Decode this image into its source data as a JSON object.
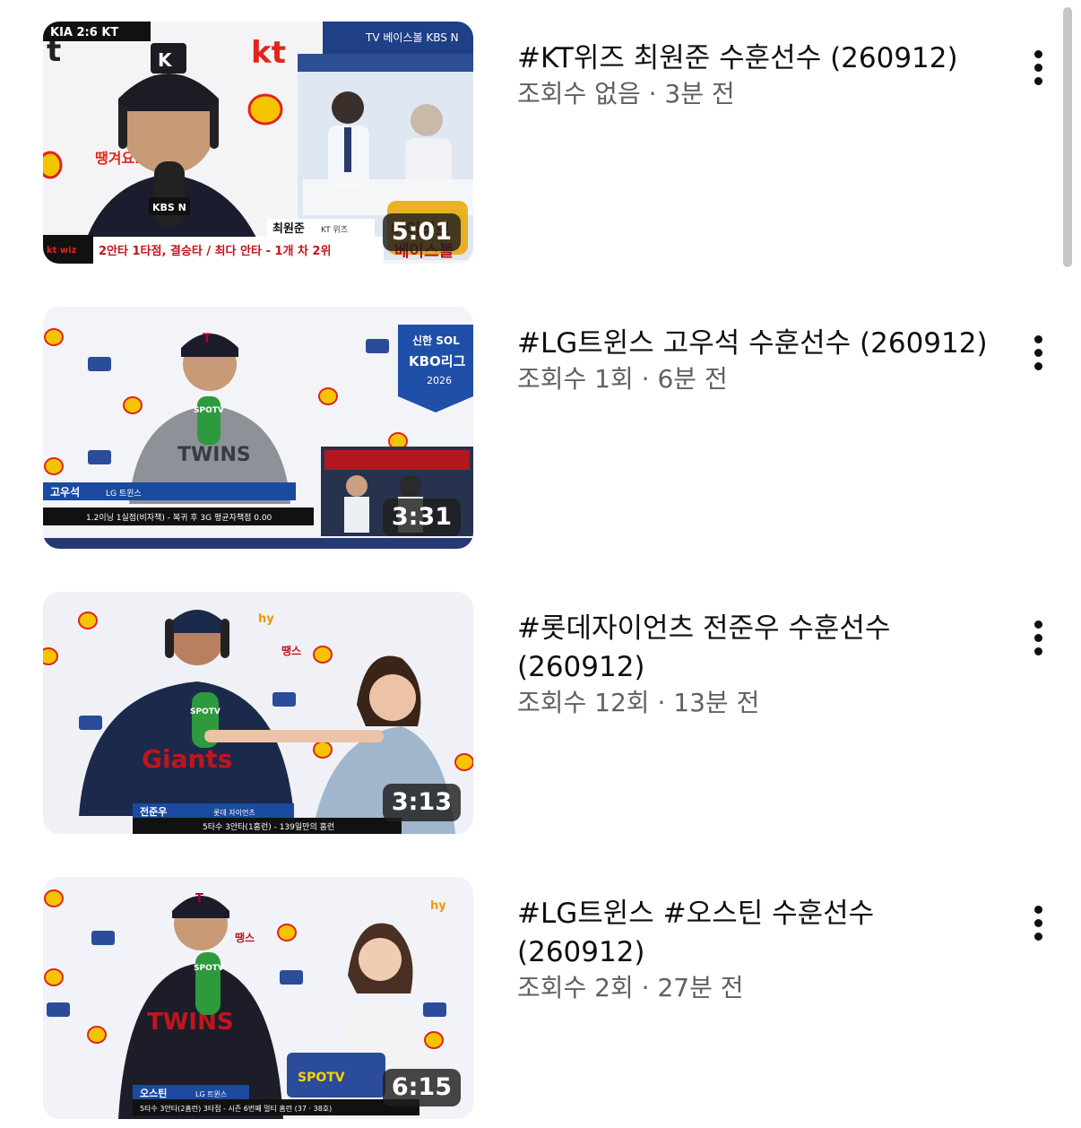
{
  "videos": [
    {
      "title": "#KT위즈 최원준 수훈선수 (260912)",
      "views": "조회수 없음",
      "age": "3분 전",
      "separator": "·",
      "duration": "5:01",
      "thumb_text": {
        "score": "KIA 2:6 KT",
        "player_name": "최원준",
        "team": "KT 위즈",
        "caption": "2안타 1타점, 결승타 / 최다 안타 - 1개 차 2위",
        "mic_label": "KBS N",
        "brand": "kt",
        "logo": "kt wiz"
      }
    },
    {
      "title": "#LG트윈스 고우석 수훈선수 (260912)",
      "views": "조회수 1회",
      "age": "6분 전",
      "separator": "·",
      "duration": "3:31",
      "thumb_text": {
        "player_name": "고우석",
        "team": "LG 트윈스",
        "caption": "1.2이닝 1실점(비자책) - 복귀 후 3G 평균자책점 0.00",
        "mic_label": "SPOTV",
        "badge_top": "신한 SOL",
        "badge_main": "KBO리그",
        "badge_year": "2026"
      }
    },
    {
      "title": "#롯데자이언츠 전준우 수훈선수 (260912)",
      "views": "조회수 12회",
      "age": "13분 전",
      "separator": "·",
      "duration": "3:13",
      "thumb_text": {
        "player_name": "전준우",
        "team": "롯데 자이언츠",
        "caption": "5타수 3안타(1홈런) - 139일만의 홈런",
        "mic_label": "SPOTV",
        "jersey": "Giants"
      }
    },
    {
      "title": "#LG트윈스 #오스틴 수훈선수 (260912)",
      "views": "조회수 2회",
      "age": "27분 전",
      "separator": "·",
      "duration": "6:15",
      "thumb_text": {
        "player_name": "오스틴",
        "team": "LG 트윈스",
        "caption": "5타수 3안타(2홈런) 3타점 - 시즌 6번째 멀티 홈런 (37 · 38호)",
        "mic_label": "SPOTV",
        "jersey": "TWINS"
      }
    }
  ],
  "icons": {
    "menu": "more-vert-icon"
  },
  "colors": {
    "title": "#0f0f0f",
    "subtitle": "#606060",
    "duration_bg": "#1e1e1e",
    "kt_red": "#e1251b",
    "lg_maroon": "#a50034",
    "lotte_navy": "#1b2a4a"
  }
}
